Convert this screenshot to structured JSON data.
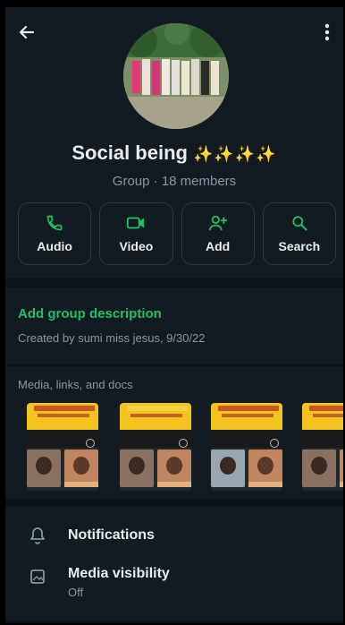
{
  "group": {
    "name": "Social being",
    "sparkles": "✨✨✨✨",
    "subtitle": "Group · 18 members"
  },
  "actions": [
    {
      "label": "Audio",
      "icon": "phone-icon"
    },
    {
      "label": "Video",
      "icon": "video-camera-icon"
    },
    {
      "label": "Add",
      "icon": "add-person-icon"
    },
    {
      "label": "Search",
      "icon": "search-icon"
    }
  ],
  "description": {
    "add_label": "Add group description",
    "created": "Created by sumi miss jesus, 9/30/22"
  },
  "media": {
    "title": "Media, links, and docs"
  },
  "settings": [
    {
      "title": "Notifications",
      "subtitle": "",
      "icon": "bell-icon"
    },
    {
      "title": "Media visibility",
      "subtitle": "Off",
      "icon": "image-icon"
    }
  ],
  "colors": {
    "accent": "#21c063",
    "background": "#111b21",
    "text_primary": "#e9edef",
    "text_secondary": "#8696a0"
  }
}
